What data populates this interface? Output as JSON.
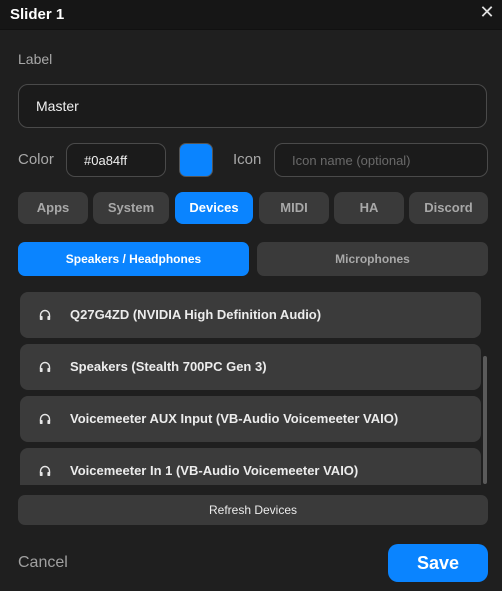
{
  "window": {
    "title": "Slider 1",
    "close_glyph": "✕"
  },
  "form": {
    "label_caption": "Label",
    "label_value": "Master",
    "color_caption": "Color",
    "color_value": "#0a84ff",
    "swatch_color": "#0a84ff",
    "icon_caption": "Icon",
    "icon_value": "",
    "icon_placeholder": "Icon name (optional)"
  },
  "tabs": [
    {
      "label": "Apps",
      "active": false
    },
    {
      "label": "System",
      "active": false
    },
    {
      "label": "Devices",
      "active": true
    },
    {
      "label": "MIDI",
      "active": false
    },
    {
      "label": "HA",
      "active": false
    },
    {
      "label": "Discord",
      "active": false
    }
  ],
  "subtabs": [
    {
      "label": "Speakers / Headphones",
      "active": true
    },
    {
      "label": "Microphones",
      "active": false
    }
  ],
  "devices": [
    {
      "name": "Q27G4ZD (NVIDIA High Definition Audio)",
      "icon": "headphones-icon"
    },
    {
      "name": "Speakers (Stealth 700PC Gen 3)",
      "icon": "headphones-icon"
    },
    {
      "name": "Voicemeeter AUX Input (VB-Audio Voicemeeter VAIO)",
      "icon": "headphones-icon"
    },
    {
      "name": "Voicemeeter In 1 (VB-Audio Voicemeeter VAIO)",
      "icon": "headphones-icon"
    }
  ],
  "actions": {
    "refresh_label": "Refresh Devices",
    "cancel_label": "Cancel",
    "save_label": "Save"
  },
  "colors": {
    "accent": "#0a84ff",
    "background": "#1f1f1f",
    "surface": "#3a3a3a"
  }
}
